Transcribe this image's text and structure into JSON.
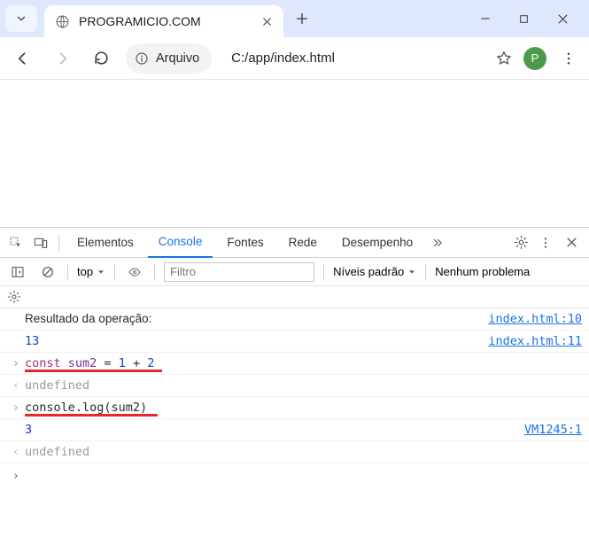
{
  "browser": {
    "tab_title": "PROGRAMICIO.COM",
    "url_chip_label": "Arquivo",
    "url_path": "C:/app/index.html",
    "avatar_initial": "P"
  },
  "devtools": {
    "tabs": {
      "elements": "Elementos",
      "console": "Console",
      "sources": "Fontes",
      "network": "Rede",
      "performance": "Desempenho"
    },
    "console_toolbar": {
      "context": "top",
      "filter_placeholder": "Filtro",
      "levels": "Níveis padrão",
      "issues": "Nenhum problema"
    },
    "lines": [
      {
        "kind": "log",
        "text": "Resultado da operação:",
        "src": "index.html:10"
      },
      {
        "kind": "log",
        "num": "13",
        "src": "index.html:11"
      },
      {
        "kind": "input",
        "tokens": [
          "const",
          " ",
          "sum2",
          " = ",
          "1",
          " + ",
          "2"
        ],
        "underline_width": 155
      },
      {
        "kind": "return",
        "text": "undefined"
      },
      {
        "kind": "input",
        "tokens_plain": "console.log(sum2)",
        "underline_width": 150
      },
      {
        "kind": "log",
        "num": "3",
        "src": "VM1245:1"
      },
      {
        "kind": "return",
        "text": "undefined"
      }
    ]
  }
}
